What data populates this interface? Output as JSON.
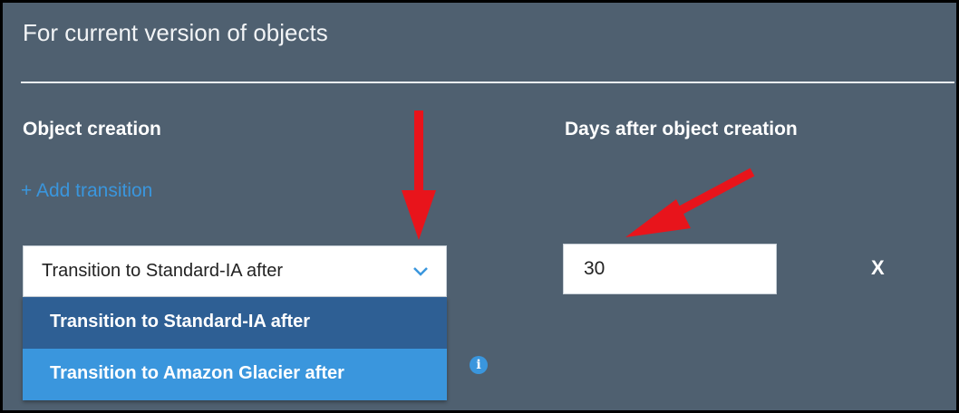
{
  "section": {
    "title": "For current version of objects"
  },
  "columns": {
    "creation_label": "Object creation",
    "days_label": "Days after object creation"
  },
  "add_transition": "+ Add transition",
  "transition": {
    "selected": "Transition to Standard-IA after",
    "options": [
      "Transition to Standard-IA after",
      "Transition to Amazon Glacier after"
    ],
    "days_value": "30",
    "remove_label": "X"
  },
  "icons": {
    "dropdown": "chevron-down-icon",
    "info": "info-icon",
    "annotation": "red-arrow"
  },
  "colors": {
    "panel_bg": "#4f6070",
    "link": "#3a96dd",
    "option_selected": "#2e5f94",
    "option_hover": "#3a96dd",
    "annotation_arrow": "#e8141b"
  }
}
